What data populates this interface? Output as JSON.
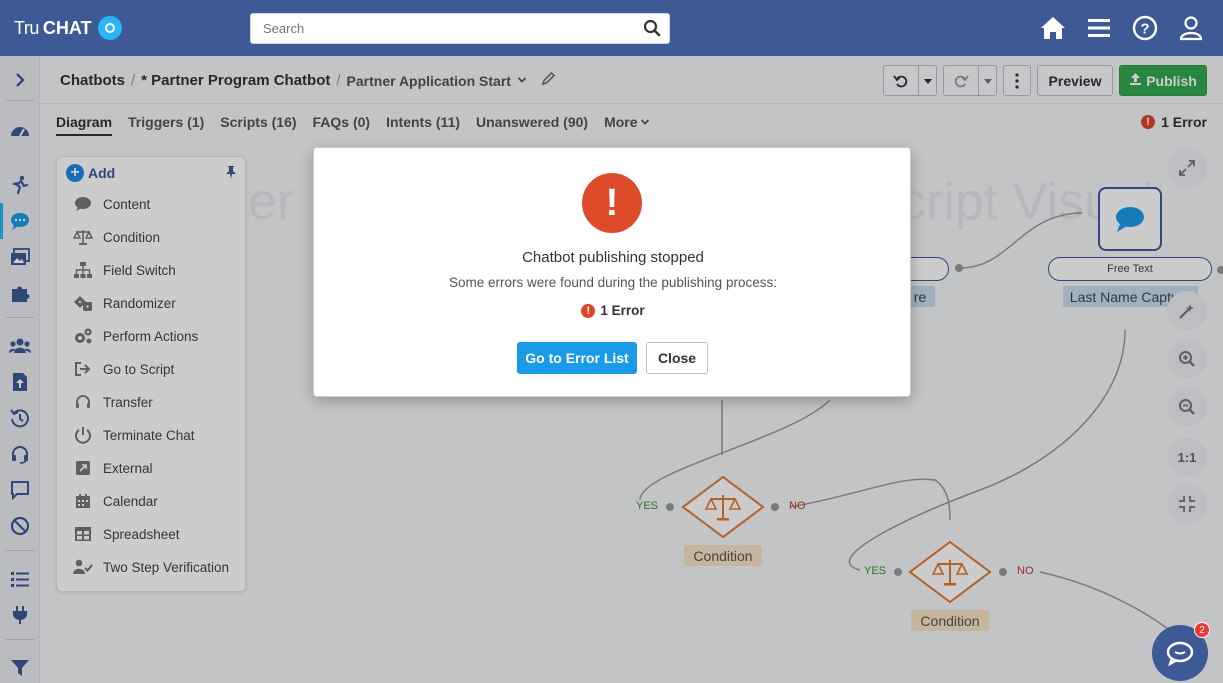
{
  "header": {
    "logo_tru": "Tru",
    "logo_chat": "CHAT",
    "search_placeholder": "Search"
  },
  "breadcrumb": {
    "item1": "Chatbots",
    "sep": "/",
    "item2": "* Partner Program Chatbot",
    "item3": "Partner Application Start"
  },
  "toolbar": {
    "preview_label": "Preview",
    "publish_label": "Publish"
  },
  "tabs": [
    {
      "label": "Diagram"
    },
    {
      "label": "Triggers (1)"
    },
    {
      "label": "Scripts (16)"
    },
    {
      "label": "FAQs (0)"
    },
    {
      "label": "Intents (11)"
    },
    {
      "label": "Unanswered (90)"
    },
    {
      "label": "More"
    }
  ],
  "error_count": "1 Error",
  "add_panel": {
    "title": "Add",
    "items": [
      {
        "label": "Content",
        "icon": "speech-bubble-icon"
      },
      {
        "label": "Condition",
        "icon": "scales-icon"
      },
      {
        "label": "Field Switch",
        "icon": "hierarchy-icon"
      },
      {
        "label": "Randomizer",
        "icon": "dice-icon"
      },
      {
        "label": "Perform Actions",
        "icon": "gears-icon"
      },
      {
        "label": "Go to Script",
        "icon": "arrow-out-icon"
      },
      {
        "label": "Transfer",
        "icon": "headset-icon"
      },
      {
        "label": "Terminate Chat",
        "icon": "power-icon"
      },
      {
        "label": "External",
        "icon": "external-icon"
      },
      {
        "label": "Calendar",
        "icon": "calendar-icon"
      },
      {
        "label": "Spreadsheet",
        "icon": "table-icon"
      },
      {
        "label": "Two Step Verification",
        "icon": "user-check-icon"
      }
    ]
  },
  "diagram": {
    "watermark_left": "er",
    "watermark_right": "cript Visual",
    "condition1_label": "Condition",
    "condition2_label": "Condition",
    "yes": "YES",
    "no": "NO",
    "free_text": "Free Text",
    "last_name_capture": "Last Name Capture",
    "capture_partial": "re"
  },
  "zoom": {
    "one_to_one": "1:1"
  },
  "modal": {
    "title": "Chatbot publishing stopped",
    "subtitle": "Some errors were found during the publishing process:",
    "error_text": "1 Error",
    "goto_label": "Go to Error List",
    "close_label": "Close"
  },
  "chat_fab": {
    "badge": "2"
  },
  "colors": {
    "header_bg": "#3d5a96",
    "publish_green": "#33a852",
    "error_red": "#dd4b2b",
    "primary_blue": "#1a9be8",
    "condition_orange": "#e07a2e"
  }
}
